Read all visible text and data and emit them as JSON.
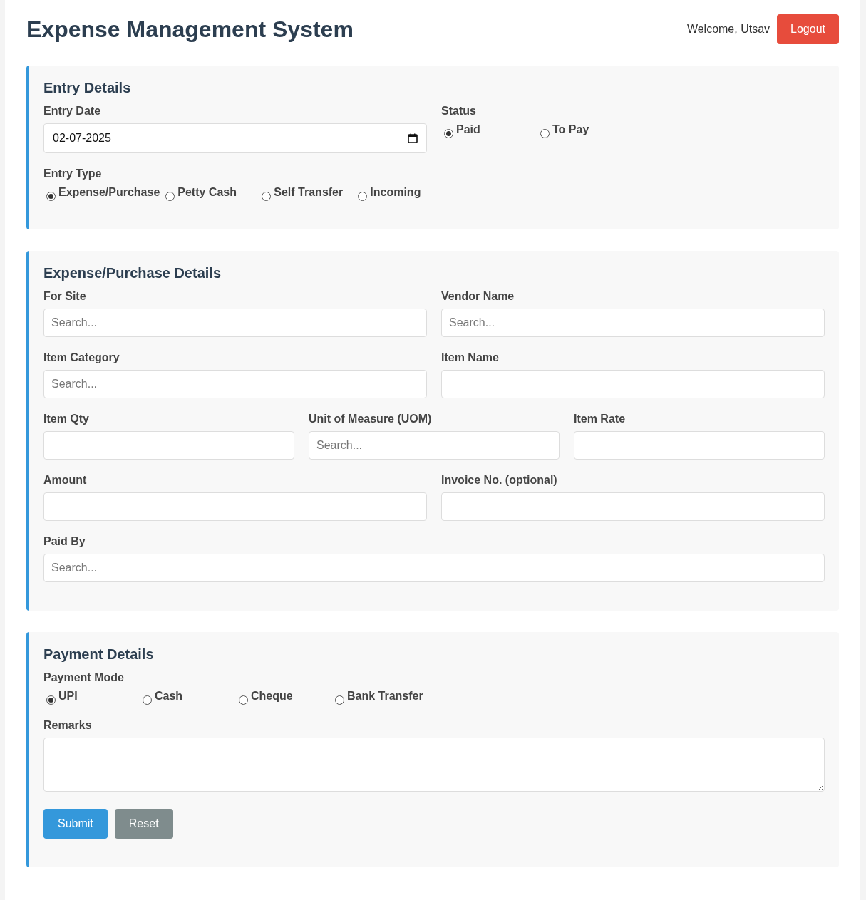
{
  "header": {
    "title": "Expense Management System",
    "welcome": "Welcome, Utsav",
    "logout": "Logout"
  },
  "sections": [
    {
      "title": "Entry Details",
      "rows": [
        [
          {
            "kind": "date",
            "label": "Entry Date",
            "value": "02-07-2025"
          },
          {
            "kind": "radio",
            "label": "Status",
            "options": [
              {
                "label": "Paid",
                "selected": true
              },
              {
                "label": "To Pay",
                "selected": false
              }
            ]
          }
        ],
        [
          {
            "kind": "radio",
            "label": "Entry Type",
            "options": [
              {
                "label": "Expense/Purchase",
                "selected": true
              },
              {
                "label": "Petty Cash",
                "selected": false
              },
              {
                "label": "Self Transfer",
                "selected": false
              },
              {
                "label": "Incoming",
                "selected": false
              }
            ]
          }
        ]
      ]
    },
    {
      "title": "Expense/Purchase Details",
      "rows": [
        [
          {
            "kind": "search",
            "label": "For Site",
            "placeholder": "Search..."
          },
          {
            "kind": "search",
            "label": "Vendor Name",
            "placeholder": "Search..."
          }
        ],
        [
          {
            "kind": "search",
            "label": "Item Category",
            "placeholder": "Search..."
          },
          {
            "kind": "text",
            "label": "Item Name"
          }
        ],
        [
          {
            "kind": "text",
            "label": "Item Qty"
          },
          {
            "kind": "search",
            "label": "Unit of Measure (UOM)",
            "placeholder": "Search..."
          },
          {
            "kind": "text",
            "label": "Item Rate"
          }
        ],
        [
          {
            "kind": "text",
            "label": "Amount"
          },
          {
            "kind": "text",
            "label": "Invoice No. (optional)"
          }
        ],
        [
          {
            "kind": "search",
            "label": "Paid By",
            "placeholder": "Search..."
          }
        ]
      ]
    },
    {
      "title": "Payment Details",
      "rows": [
        [
          {
            "kind": "radio",
            "label": "Payment Mode",
            "options": [
              {
                "label": "UPI",
                "selected": true
              },
              {
                "label": "Cash",
                "selected": false
              },
              {
                "label": "Cheque",
                "selected": false
              },
              {
                "label": "Bank Transfer",
                "selected": false
              }
            ]
          }
        ],
        [
          {
            "kind": "textarea",
            "label": "Remarks"
          }
        ]
      ],
      "buttons": [
        {
          "label": "Submit",
          "kind": "primary"
        },
        {
          "label": "Reset",
          "kind": "secondary"
        }
      ]
    }
  ]
}
